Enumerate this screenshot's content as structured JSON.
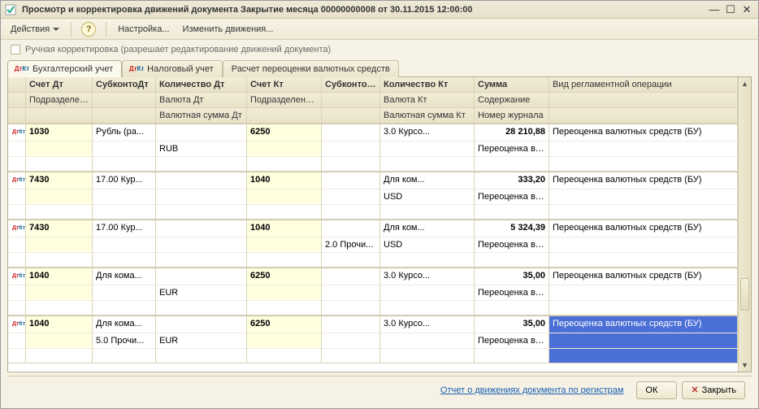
{
  "titlebar": {
    "title": "Просмотр и корректировка движений документа Закрытие месяца 00000000008 от 30.11.2015 12:00:00"
  },
  "toolbar": {
    "actions": "Действия",
    "settings": "Настройка...",
    "change_moves": "Изменить движения...",
    "help": "?"
  },
  "manual": {
    "label": "Ручная корректировка (разрешает редактирование движений документа)"
  },
  "tabs": {
    "acc": "Бухгалтерский учет",
    "tax": "Налоговый учет",
    "fx": "Расчет переоценки валютных средств"
  },
  "headers": {
    "acc_dt": "Счет Дт",
    "subk_dt": "СубконтоДт",
    "qty_dt": "Количество Дт",
    "acc_kt": "Счет Кт",
    "subk_kt": "СубконтоКт",
    "qty_kt": "Количество Кт",
    "sum": "Сумма",
    "op": "Вид регламентной операции",
    "div_dt": "Подразделение Дт",
    "cur_dt": "Валюта Дт",
    "div_kt": "Подразделение Кт",
    "cur_kt": "Валюта Кт",
    "content": "Содержание",
    "fx_dt": "Валютная сумма Дт",
    "fx_kt": "Валютная сумма Кт",
    "journal": "Номер журнала"
  },
  "rows": [
    {
      "acc_dt": "1030",
      "sub_dt": "Рубль (ра...",
      "qty_dt": "",
      "acc_kt": "6250",
      "sub_kt": "",
      "qty_kt": "3.0 Курсо...",
      "sum": "28 210,88",
      "op": "Переоценка валютных средств (БУ)",
      "div_dt": "",
      "cur_dt": "RUB",
      "div_kt": "",
      "cur_kt2": "",
      "content": "Переоценка ва...",
      "fx_dt": "",
      "fx_kt": "",
      "journal": "",
      "sub_dt2": "",
      "sub_kt2": ""
    },
    {
      "acc_dt": "7430",
      "sub_dt": "17.00 Кур...",
      "qty_dt": "",
      "acc_kt": "1040",
      "sub_kt": "",
      "qty_kt": "Для ком...",
      "sum": "333,20",
      "op": "Переоценка валютных средств (БУ)",
      "div_dt": "",
      "cur_dt": "",
      "div_kt": "",
      "cur_kt2": "USD",
      "content": "Переоценка ва...",
      "fx_dt": "",
      "fx_kt": "",
      "journal": "",
      "sub_dt2": "",
      "sub_kt2": ""
    },
    {
      "acc_dt": "7430",
      "sub_dt": "17.00 Кур...",
      "qty_dt": "",
      "acc_kt": "1040",
      "sub_kt": "",
      "qty_kt": "Для ком...",
      "sum": "5 324,39",
      "op": "Переоценка валютных средств (БУ)",
      "div_dt": "",
      "cur_dt": "",
      "div_kt": "",
      "cur_kt2": "USD",
      "content": "Переоценка ва...",
      "fx_dt": "",
      "fx_kt": "",
      "journal": "",
      "sub_dt2": "",
      "sub_kt2": "2.0 Прочи..."
    },
    {
      "acc_dt": "1040",
      "sub_dt": "Для кома...",
      "qty_dt": "",
      "acc_kt": "6250",
      "sub_kt": "",
      "qty_kt": "3.0 Курсо...",
      "sum": "35,00",
      "op": "Переоценка валютных средств (БУ)",
      "div_dt": "",
      "cur_dt": "EUR",
      "div_kt": "",
      "cur_kt2": "",
      "content": "Переоценка ва...",
      "fx_dt": "",
      "fx_kt": "",
      "journal": "",
      "sub_dt2": "",
      "sub_kt2": ""
    },
    {
      "acc_dt": "1040",
      "sub_dt": "Для кома...",
      "qty_dt": "",
      "acc_kt": "6250",
      "sub_kt": "",
      "qty_kt": "3.0 Курсо...",
      "sum": "35,00",
      "op": "Переоценка валютных средств (БУ)",
      "div_dt": "",
      "cur_dt": "EUR",
      "div_kt": "",
      "cur_kt2": "",
      "content": "Переоценка ва...",
      "fx_dt": "",
      "fx_kt": "",
      "journal": "",
      "sub_dt2": "5.0 Прочи...",
      "sub_kt2": ""
    }
  ],
  "footer": {
    "report_link": "Отчет о движениях документа по регистрам",
    "ok": "ОК",
    "close": "Закрыть"
  }
}
